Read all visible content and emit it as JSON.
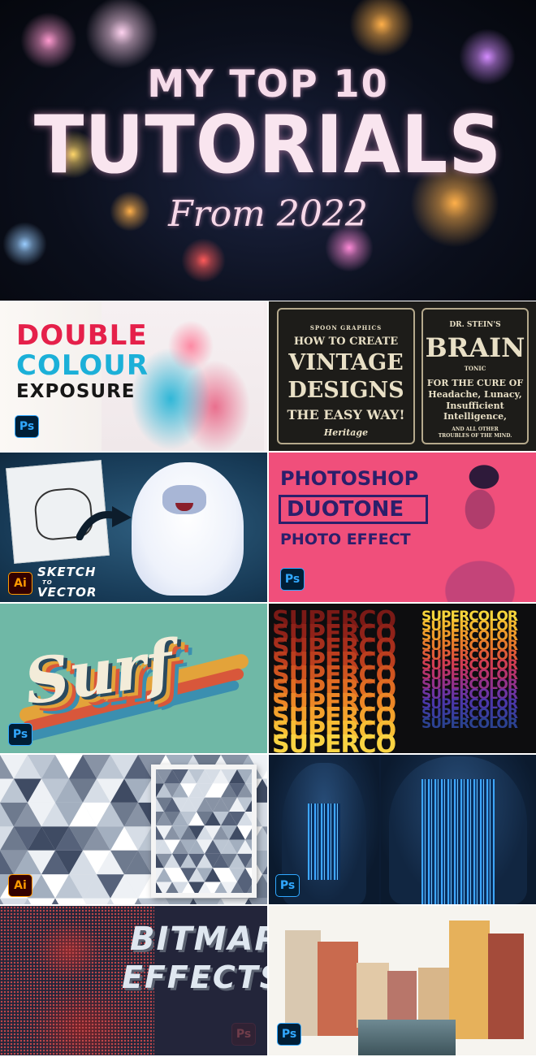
{
  "hero": {
    "line1": "MY TOP 10",
    "line2": "TUTORIALS",
    "line3": "From 2022"
  },
  "badges": {
    "ps": "Ps",
    "ai": "Ai"
  },
  "tiles": {
    "double_colour": {
      "w1": "DOUBLE",
      "w2": "COLOUR",
      "w3": "EXPOSURE",
      "app": "ps"
    },
    "vintage": {
      "a": "SPOON GRAPHICS",
      "b": "HOW TO CREATE",
      "c": "VINTAGE",
      "d": "DESIGNS",
      "e": "THE EASY WAY!",
      "f": "Heritage",
      "g": "DR. STEIN'S",
      "h": "BRAIN",
      "i": "TONIC",
      "j": "FOR THE CURE OF\nHeadache, Lunacy,\nInsufficient\nIntelligence,",
      "k": "AND ALL OTHER\nTROUBLES OF THE MIND."
    },
    "sketch_vector": {
      "a": "SKETCH",
      "b": "TO",
      "c": "VECTOR",
      "app": "ai"
    },
    "duotone": {
      "a": "PHOTOSHOP",
      "b": "DUOTONE",
      "c": "PHOTO EFFECT",
      "app": "ps"
    },
    "surf": {
      "word": "Surf",
      "app": "ps"
    },
    "supercolor": {
      "left_word": "SUPERCO",
      "right_word": "SUPERCOLOR"
    },
    "triangles": {
      "app": "ai"
    },
    "hooded": {
      "app": "ps"
    },
    "bitmap": {
      "a": "BITMAP",
      "b": "EFFECTS",
      "app": "ps"
    },
    "venice": {
      "app": "ps"
    }
  },
  "colors": {
    "ps_bg": "#001e36",
    "ps_fg": "#31a8ff",
    "ai_bg": "#330000",
    "ai_fg": "#ff9a00",
    "duotone_pink": "#f04f7b",
    "duotone_navy": "#2b1f6b"
  }
}
